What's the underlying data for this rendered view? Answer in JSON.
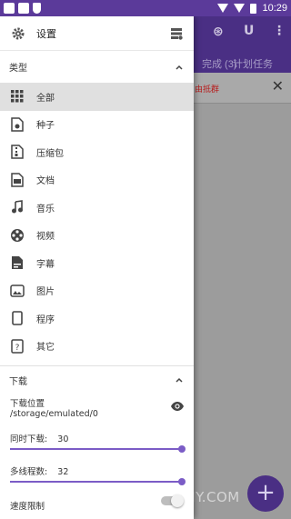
{
  "status_bar": {
    "time": "10:29"
  },
  "background": {
    "tab1": "完成 (3)",
    "tab2": "计划任务",
    "warning": "由抵群",
    "fab_icon": "plus-icon",
    "watermark": "飞下载 · BYFONY.COM",
    "accent": "#4a2f84"
  },
  "drawer": {
    "title": "设置",
    "categories_label": "类型",
    "categories": [
      {
        "label": "全部",
        "icon": "grid-icon",
        "selected": true
      },
      {
        "label": "种子",
        "icon": "torrent-file-icon",
        "selected": false
      },
      {
        "label": "压缩包",
        "icon": "archive-icon",
        "selected": false
      },
      {
        "label": "文档",
        "icon": "document-icon",
        "selected": false
      },
      {
        "label": "音乐",
        "icon": "music-note-icon",
        "selected": false
      },
      {
        "label": "视频",
        "icon": "film-reel-icon",
        "selected": false
      },
      {
        "label": "字幕",
        "icon": "subtitle-file-icon",
        "selected": false
      },
      {
        "label": "图片",
        "icon": "image-icon",
        "selected": false
      },
      {
        "label": "程序",
        "icon": "phone-icon",
        "selected": false
      },
      {
        "label": "其它",
        "icon": "question-file-icon",
        "selected": false
      }
    ],
    "download_label": "下载",
    "download_location_label": "下载位置",
    "download_location_value": "/storage/emulated/0",
    "simultaneous_label": "同时下载:",
    "simultaneous_value": "30",
    "simultaneous_level": 1.0,
    "threads_label": "多线程数:",
    "threads_value": "32",
    "threads_level": 1.0,
    "speed_limit_label": "速度限制",
    "speed_limit_enabled": false,
    "accent": "#7b5cc6"
  }
}
